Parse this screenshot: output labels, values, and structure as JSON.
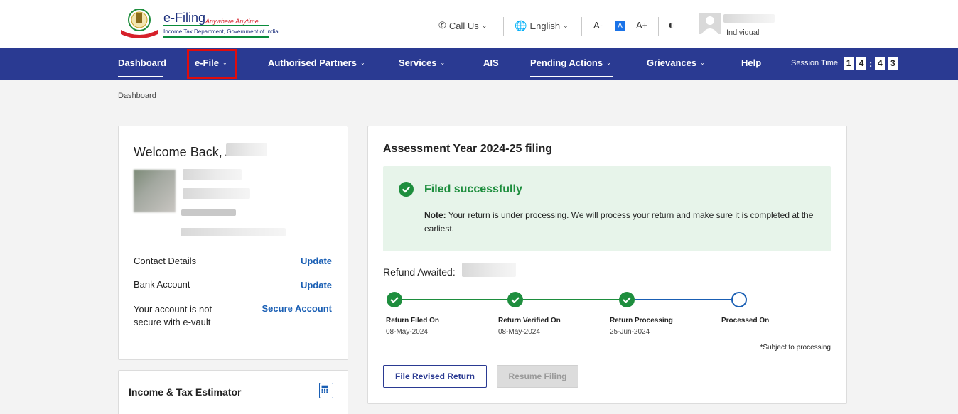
{
  "header": {
    "brand": "e-Filing",
    "tagline": "Anywhere Anytime",
    "subtitle": "Income Tax Department, Government of India",
    "call_us": "Call Us",
    "language": "English",
    "font_decrease": "A-",
    "font_normal": "A",
    "font_increase": "A+",
    "user_role": "Individual"
  },
  "nav": {
    "items": [
      {
        "label": "Dashboard"
      },
      {
        "label": "e-File"
      },
      {
        "label": "Authorised Partners"
      },
      {
        "label": "Services"
      },
      {
        "label": "AIS"
      },
      {
        "label": "Pending Actions"
      },
      {
        "label": "Grievances"
      },
      {
        "label": "Help"
      }
    ],
    "session_label": "Session Time",
    "session_digits": [
      "1",
      "4",
      "4",
      "3"
    ],
    "session_sep": ":"
  },
  "breadcrumb": "Dashboard",
  "welcome": {
    "greeting": "Welcome Back, A",
    "contact_label": "Contact Details",
    "contact_link": "Update",
    "bank_label": "Bank Account",
    "bank_link": "Update",
    "secure_label": "Your account is not secure with e-vault",
    "secure_link": "Secure Account"
  },
  "estimator": {
    "title": "Income & Tax Estimator"
  },
  "filing": {
    "title": "Assessment Year 2024-25 filing",
    "status": "Filed successfully",
    "note_label": "Note:",
    "note_text": " Your return is under processing. We will process your return and make sure it is completed at the earliest.",
    "refund_label": "Refund Awaited:",
    "steps": [
      {
        "label": "Return Filed On",
        "date": "08-May-2024",
        "done": true
      },
      {
        "label": "Return Verified On",
        "date": "08-May-2024",
        "done": true
      },
      {
        "label": "Return Processing",
        "date": "25-Jun-2024",
        "done": true
      },
      {
        "label": "Processed On",
        "date": "",
        "done": false
      }
    ],
    "footnote": "*Subject to processing",
    "btn_revised": "File Revised Return",
    "btn_resume": "Resume Filing"
  },
  "colors": {
    "nav_bg": "#2a3a92",
    "success_green": "#1e8e3e",
    "link_blue": "#1a5fb4",
    "highlight_red": "#e10c0c"
  }
}
